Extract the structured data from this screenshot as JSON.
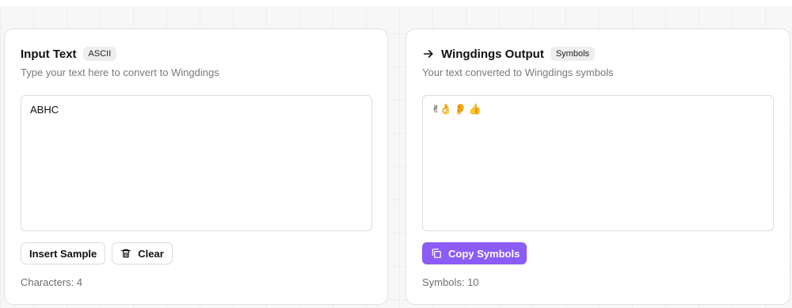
{
  "input_panel": {
    "title": "Input Text",
    "badge": "ASCII",
    "subtitle": "Type your text here to convert to Wingdings",
    "value": "ABHC",
    "insert_sample_label": "Insert Sample",
    "clear_label": "Clear",
    "count_text": "Characters: 4"
  },
  "output_panel": {
    "title": "Wingdings Output",
    "badge": "Symbols",
    "subtitle": "Your text converted to Wingdings symbols",
    "value": "✌👌 👂 👍",
    "copy_label": "Copy Symbols",
    "count_text": "Symbols: 10"
  },
  "icons": {
    "output_title": "arrow-right-icon",
    "clear": "trash-icon",
    "copy": "copy-icon"
  },
  "colors": {
    "accent": "#8b5cf6",
    "badge_bg": "#eeeeee",
    "muted_text": "#7a7a7a"
  }
}
